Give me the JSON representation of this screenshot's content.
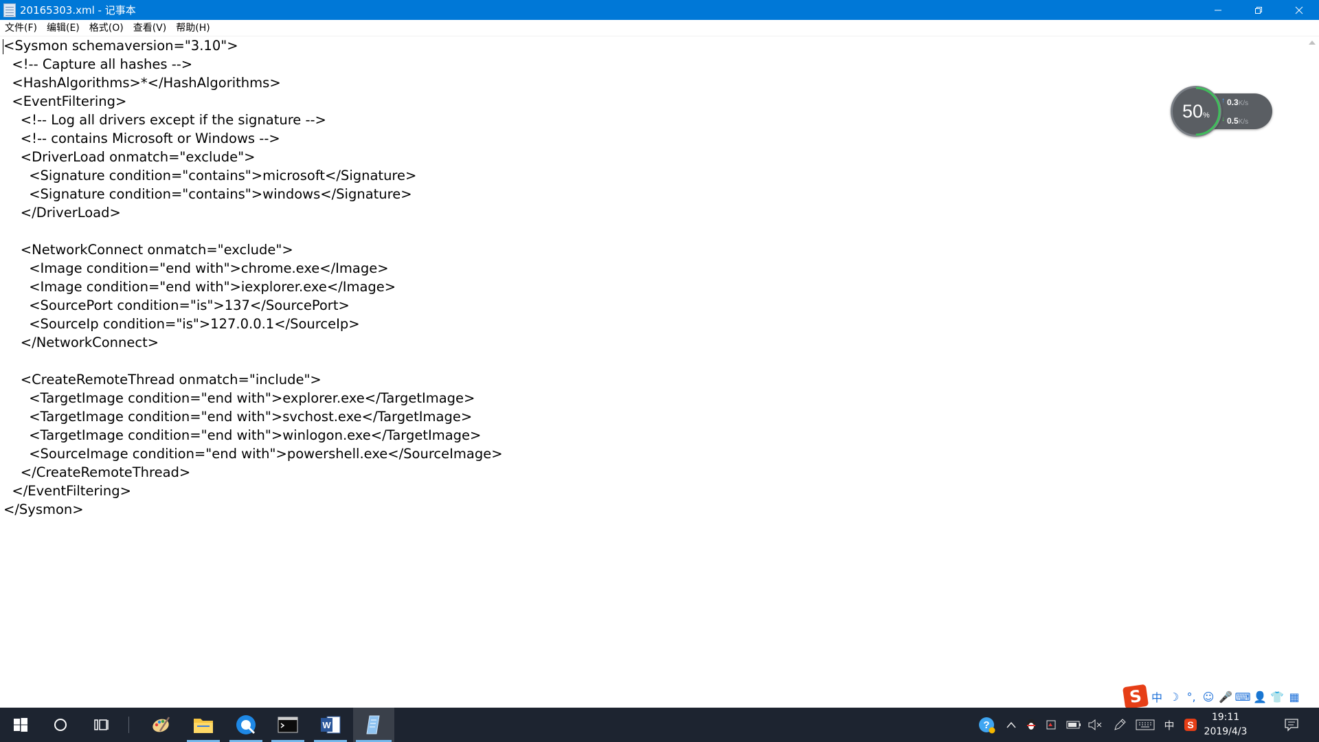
{
  "window": {
    "title": "20165303.xml - 记事本",
    "minimize_glyph": "─",
    "maximize_glyph": "❐",
    "close_glyph": "✕"
  },
  "menu": {
    "file": "文件(F)",
    "edit": "编辑(E)",
    "format": "格式(O)",
    "view": "查看(V)",
    "help": "帮助(H)"
  },
  "editor": {
    "content": "<Sysmon schemaversion=\"3.10\">\n  <!-- Capture all hashes -->\n  <HashAlgorithms>*</HashAlgorithms>\n  <EventFiltering>\n    <!-- Log all drivers except if the signature -->\n    <!-- contains Microsoft or Windows -->\n    <DriverLoad onmatch=\"exclude\">\n      <Signature condition=\"contains\">microsoft</Signature>\n      <Signature condition=\"contains\">windows</Signature>\n    </DriverLoad>\n\n    <NetworkConnect onmatch=\"exclude\">\n      <Image condition=\"end with\">chrome.exe</Image>\n      <Image condition=\"end with\">iexplorer.exe</Image>\n      <SourcePort condition=\"is\">137</SourcePort>\n      <SourceIp condition=\"is\">127.0.0.1</SourceIp>\n    </NetworkConnect>\n\n    <CreateRemoteThread onmatch=\"include\">\n      <TargetImage condition=\"end with\">explorer.exe</TargetImage>\n      <TargetImage condition=\"end with\">svchost.exe</TargetImage>\n      <TargetImage condition=\"end with\">winlogon.exe</TargetImage>\n      <SourceImage condition=\"end with\">powershell.exe</SourceImage>\n    </CreateRemoteThread>\n  </EventFiltering>\n</Sysmon>"
  },
  "netmon": {
    "percent": "50",
    "percent_unit": "%",
    "upload": "0.3",
    "download": "0.5",
    "unit": "K/s",
    "up_arrow": "↑",
    "down_arrow": "↓",
    "load_fraction": 0.5
  },
  "ime": {
    "logo": "S",
    "mode": "中",
    "moon": "☽",
    "punct": "°,",
    "emoji": "☺",
    "mic": "🎤",
    "keyboard": "⌨",
    "user": "👤",
    "shirt": "👕",
    "grid": "▦"
  },
  "taskbar": {
    "apps": [
      "start",
      "cortana",
      "task-view",
      "paint",
      "file-explorer",
      "qq-browser",
      "terminal",
      "word",
      "notepad"
    ],
    "word_letter": "W"
  },
  "tray": {
    "help": "?",
    "chevron": "^",
    "ime_lang": "中",
    "time": "19:11",
    "date": "2019/4/3",
    "sogou": "S"
  },
  "colors": {
    "titlebar": "#0078d7",
    "taskbar": "#1d2430",
    "accent": "#76b9ed"
  }
}
